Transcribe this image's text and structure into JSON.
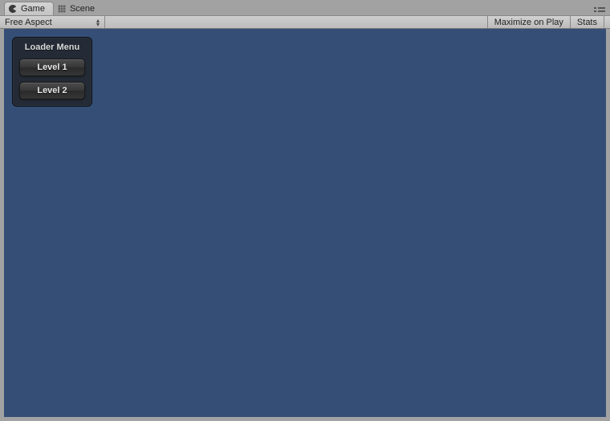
{
  "tabs": {
    "game": "Game",
    "scene": "Scene"
  },
  "toolbar": {
    "aspect": "Free Aspect",
    "maximize": "Maximize on Play",
    "stats": "Stats"
  },
  "loader": {
    "title": "Loader Menu",
    "buttons": [
      "Level 1",
      "Level 2"
    ]
  }
}
